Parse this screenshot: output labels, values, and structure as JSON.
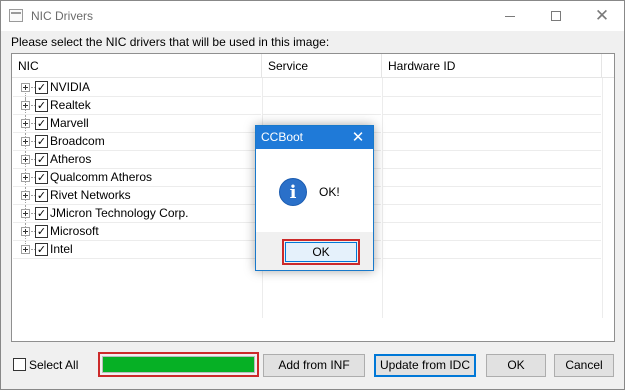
{
  "window": {
    "title": "NIC Drivers",
    "controls": {
      "minimize_icon": "minimize-icon",
      "maximize_icon": "maximize-icon",
      "close_icon": "close-icon"
    }
  },
  "instruction": "Please select the NIC drivers that will be used in this image:",
  "table": {
    "columns": [
      "NIC",
      "Service",
      "Hardware ID"
    ],
    "rows": [
      {
        "label": "NVIDIA",
        "checked": true
      },
      {
        "label": "Realtek",
        "checked": true
      },
      {
        "label": "Marvell",
        "checked": true
      },
      {
        "label": "Broadcom",
        "checked": true
      },
      {
        "label": "Atheros",
        "checked": true
      },
      {
        "label": "Qualcomm Atheros",
        "checked": true
      },
      {
        "label": "Rivet Networks",
        "checked": true
      },
      {
        "label": "JMicron Technology Corp.",
        "checked": true
      },
      {
        "label": "Microsoft",
        "checked": true
      },
      {
        "label": "Intel",
        "checked": true
      }
    ]
  },
  "footer": {
    "select_all_label": "Select All",
    "select_all_checked": false,
    "progress_fraction": 1.0,
    "progress_color": "#06b025",
    "add_from_inf": "Add from INF",
    "update_from_idc": "Update from IDC",
    "ok": "OK",
    "cancel": "Cancel"
  },
  "dialog": {
    "title": "CCBoot",
    "message": "OK!",
    "ok": "OK",
    "icon": "info-icon",
    "title_color": "#1f7ad8"
  },
  "colors": {
    "highlight_border": "#cc2a2a",
    "accent": "#0078d7"
  }
}
